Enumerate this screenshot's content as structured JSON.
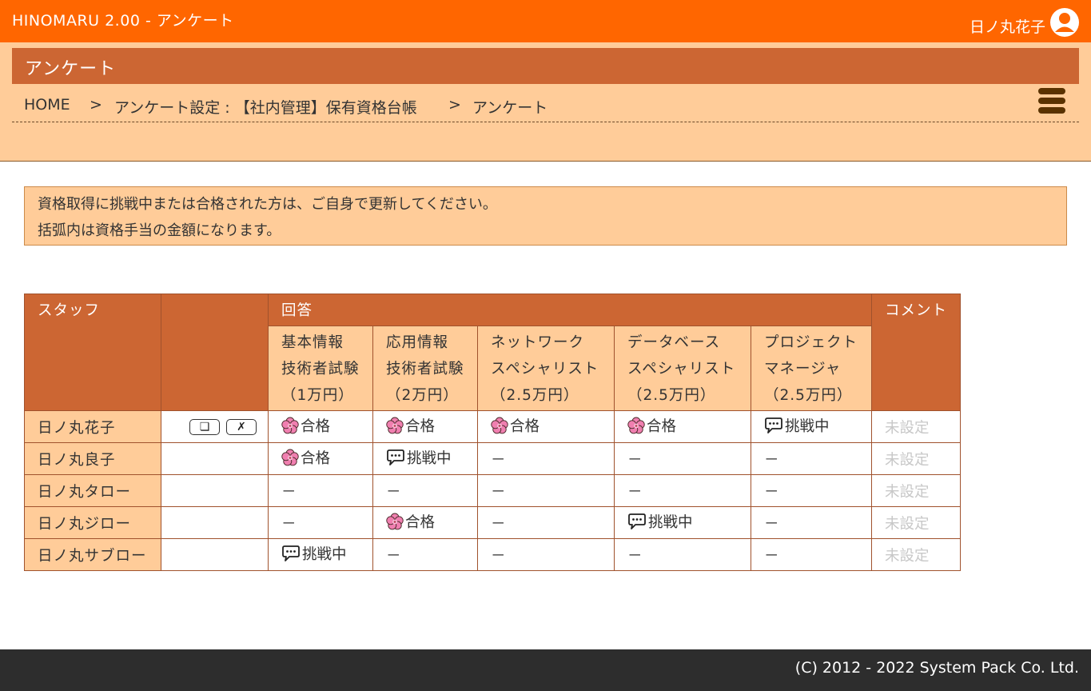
{
  "header": {
    "app_title": "HINOMARU 2.00 - アンケート",
    "user_name": "日ノ丸花子"
  },
  "page": {
    "title": "アンケート"
  },
  "breadcrumb": {
    "items": [
      "HOME",
      "アンケート設定 : 【社内管理】保有資格台帳",
      "アンケート"
    ],
    "separator": ">"
  },
  "notice": {
    "lines": [
      "資格取得に挑戦中または合格された方は、ご自身で更新してください。",
      "括弧内は資格手当の金額になります。"
    ]
  },
  "table": {
    "headers": {
      "staff": "スタッフ",
      "answer": "回答",
      "comment": "コメント"
    },
    "questions": [
      {
        "lines": [
          "基本情報",
          "技術者試験",
          "（1万円）"
        ]
      },
      {
        "lines": [
          "応用情報",
          "技術者試験",
          "（2万円）"
        ]
      },
      {
        "lines": [
          "ネットワーク",
          "スペシャリスト",
          "（2.5万円）"
        ]
      },
      {
        "lines": [
          "データベース",
          "スペシャリスト",
          "（2.5万円）"
        ]
      },
      {
        "lines": [
          "プロジェクト",
          "マネージャ",
          "（2.5万円）"
        ]
      }
    ],
    "rows": [
      {
        "staff": "日ノ丸花子",
        "has_actions": true,
        "answers": [
          {
            "type": "pass",
            "text": "合格"
          },
          {
            "type": "pass",
            "text": "合格"
          },
          {
            "type": "pass",
            "text": "合格"
          },
          {
            "type": "pass",
            "text": "合格"
          },
          {
            "type": "challenge",
            "text": "挑戦中"
          }
        ],
        "comment": "未設定"
      },
      {
        "staff": "日ノ丸良子",
        "has_actions": false,
        "answers": [
          {
            "type": "pass",
            "text": "合格"
          },
          {
            "type": "challenge",
            "text": "挑戦中"
          },
          {
            "type": "none",
            "text": "－"
          },
          {
            "type": "none",
            "text": "－"
          },
          {
            "type": "none",
            "text": "－"
          }
        ],
        "comment": "未設定"
      },
      {
        "staff": "日ノ丸タロー",
        "has_actions": false,
        "answers": [
          {
            "type": "none",
            "text": "－"
          },
          {
            "type": "none",
            "text": "－"
          },
          {
            "type": "none",
            "text": "－"
          },
          {
            "type": "none",
            "text": "－"
          },
          {
            "type": "none",
            "text": "－"
          }
        ],
        "comment": "未設定"
      },
      {
        "staff": "日ノ丸ジロー",
        "has_actions": false,
        "answers": [
          {
            "type": "none",
            "text": "－"
          },
          {
            "type": "pass",
            "text": "合格"
          },
          {
            "type": "none",
            "text": "－"
          },
          {
            "type": "challenge",
            "text": "挑戦中"
          },
          {
            "type": "none",
            "text": "－"
          }
        ],
        "comment": "未設定"
      },
      {
        "staff": "日ノ丸サブロー",
        "has_actions": false,
        "answers": [
          {
            "type": "challenge",
            "text": "挑戦中"
          },
          {
            "type": "none",
            "text": "－"
          },
          {
            "type": "none",
            "text": "－"
          },
          {
            "type": "none",
            "text": "－"
          },
          {
            "type": "none",
            "text": "－"
          }
        ],
        "comment": "未設定"
      }
    ],
    "actions": {
      "copy_glyph": "❏",
      "delete_glyph": "✗"
    }
  },
  "icons": {
    "pass": "cherry-blossom-icon",
    "challenge": "speech-bubble-icon",
    "user": "user-avatar-icon",
    "menu": "hamburger-menu-icon"
  },
  "colors": {
    "topbar": "#ff6600",
    "title_bar": "#cc6633",
    "panel": "#ffcc99",
    "footer": "#2d2d2d",
    "blossom": "#f07fb0"
  },
  "footer": {
    "copyright": "(C) 2012 - 2022 System Pack Co. Ltd."
  }
}
